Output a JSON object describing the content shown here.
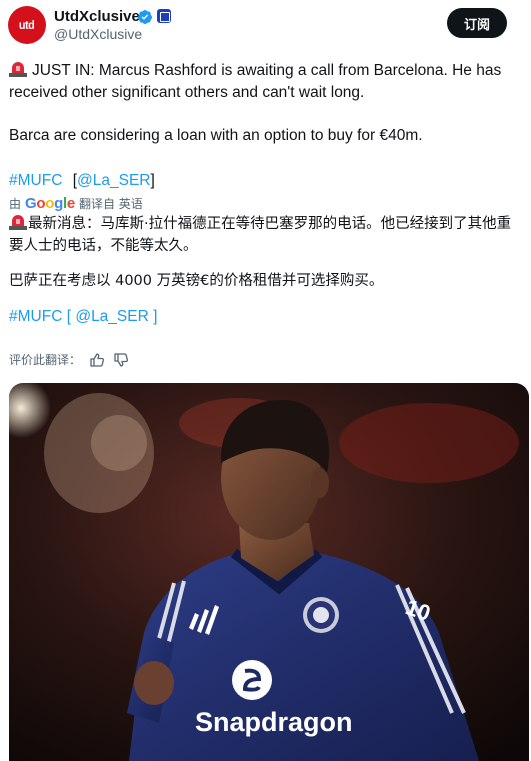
{
  "author": {
    "display_name": "UtdXclusive",
    "handle": "@UtdXclusive",
    "avatar_text": "utd"
  },
  "subscribe_label": "订阅",
  "tweet": {
    "line1_prefix": "JUST IN: Marcus Rashford is awaiting a call from Barcelona. He has received other significant others and can't wait long.",
    "line2": "Barca are considering a loan with an option to buy for €40m.",
    "hashtag": "#MUFC",
    "mention_open": "[",
    "mention": "@La_SER",
    "mention_close": "]"
  },
  "translation": {
    "by": "由",
    "google": "Google",
    "translated_from": "翻译自 英语",
    "line1": "最新消息：马库斯·拉什福德正在等待巴塞罗那的电话。他已经接到了其他重要人士的电话，不能等太久。",
    "line2": "巴萨正在考虑以 4000 万英镑€的价格租借并可选择购买。",
    "hashtag": "#MUFC",
    "mention_open": "[",
    "mention": "@La_SER",
    "mention_close": "]",
    "rate_label": "评价此翻译："
  },
  "media": {
    "sponsor_text": "Snapdragon",
    "kit_brand": "adidas"
  },
  "colors": {
    "link": "#1d9bf0",
    "avatar_red": "#d4101a",
    "verified_blue": "#1d9bf0",
    "kit_navy": "#1e2a63"
  }
}
